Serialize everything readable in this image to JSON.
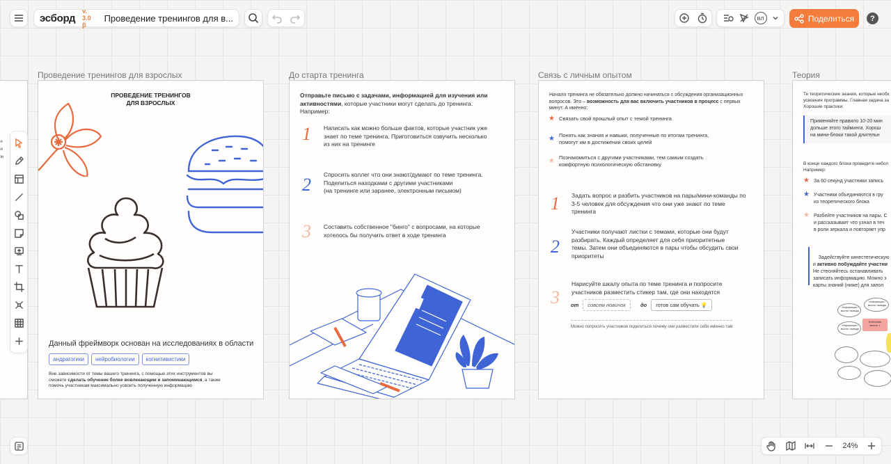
{
  "app": {
    "logo": "эсборд",
    "version": "v. 3.0 β",
    "board_title": "Проведение тренингов для в...",
    "share_label": "Поделиться",
    "avatar_initials": "ВЛ",
    "zoom": "24%",
    "accent_color": "#f47c3c"
  },
  "frames": {
    "f1": {
      "title": "Проведение тренингов для взрослых",
      "heading": "ПРОВЕДЕНИЕ ТРЕНИНГОВ\nДЛЯ ВЗРОСЛЫХ",
      "framework": "Данный фреймворк основан на исследованиях в области",
      "chips": [
        "андрагогики",
        "нейробиологии",
        "когнитивистики"
      ],
      "footer_a": "Вне зависимости от темы вашего тренинга, с помощью этих инструментов вы сможете",
      "footer_b": "сделать обучение более вовлекающим и запоминающимся",
      "footer_c": ", а также помочь участникам максимально усвоить полученную информацию"
    },
    "f2": {
      "title": "До старта тренинга",
      "intro_bold": "Отправьте письмо с задачами, информацией для изучения или активностями",
      "intro_rest": ", которые участники могут сделать до тренинга. Например:",
      "items": [
        {
          "n": "1",
          "text": "Написать как можно больше фактов, которые участник уже знает по теме тренинга. Приготовиться озвучить несколько из них на тренинге"
        },
        {
          "n": "2",
          "text": "Спросить коллег что они знают/думают по теме тренинга. Поделиться находками с другими участниками\n(на тренинге или заранее, электронным письмом)"
        },
        {
          "n": "3",
          "text": "Составить собственное \"бинго\" с вопросами, на которые хотелось бы получить ответ в ходе тренинга"
        }
      ]
    },
    "f3": {
      "title": "Связь с личным опытом",
      "intro_a": "Начало тренинга не обязательно должно начинаться с обсуждения организационных вопросов. Это – ",
      "intro_bold": "возможность для вас включить участников в процесс",
      "intro_b": " с первых минут. А именно:",
      "stars": [
        "Связать свой прошлый опыт с темой тренинга",
        "Понять как знания и навыки, полученные по итогам тренинга, помогут им в достижении своих целей",
        "Познакомиться с другими участниками, тем самым создать комфортную психологическую обстановку"
      ],
      "items": [
        {
          "n": "1",
          "text": "Задать вопрос и разбить участников на пары/мини-команды по 3-5 человек для обсуждения что они уже знают по теме тренинга"
        },
        {
          "n": "2",
          "text": "Участники получают листки с темами, которые они будут разбирать. Каждый определяет для себя приоритетные темы. Затем они объединяются в пары чтобы обсудить свои приоритеты"
        },
        {
          "n": "3",
          "text": "Нарисуйте шкалу опыта по теме тренинга и попросите участников разместить стикер там, где они находятся"
        }
      ],
      "from_label": "от",
      "from_value": "совсем новичок",
      "to_label": "до",
      "to_value": "готов сам обучать 💡",
      "footnote": "Можно попросить участников поделиться почему они разместили себя именно там"
    },
    "f4": {
      "title": "Теория",
      "intro": "Те теоретические знания, которые необх\nусвоения программы. Главная задача за\nХорошие практики:",
      "quote": "Применяйте правило 10-20 мин\nдольше этого тайминга. Хорош\nна мини-блоки такой длительн",
      "intro2": "В конце каждого блока проведите небол\nНапример:",
      "stars": [
        "За 60 секунд участники запись",
        "Участники объединяются в гру\nиз теоретического блока",
        "Разбейте участников на пары. С\nи рассказывает что узнал в теч\nв роли зеркала и повторяет упр"
      ],
      "note_a": "Задействуйте кинестетическую",
      "note_b_pre": "и ",
      "note_b_bold": "активно побуждайте участни",
      "note_c": "Не стесняйтесь останавливать\nзаписать информацию. Можно з\nкарты знаний (ниже) для запол",
      "map_center": "Ключевая\nмысль 1",
      "map_item": "Информация /\nмысли / выводы"
    }
  }
}
